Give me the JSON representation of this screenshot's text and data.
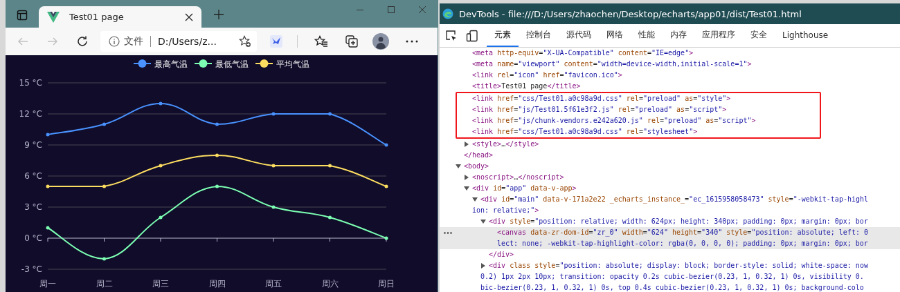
{
  "browser": {
    "tab": {
      "title": "Test01 page"
    },
    "nav_buttons": [
      {
        "kind": "back",
        "disabled": true
      },
      {
        "kind": "forward",
        "disabled": true
      },
      {
        "kind": "refresh",
        "disabled": false
      }
    ],
    "address": {
      "site_label": "文件",
      "url": "D:/Users/z..."
    },
    "chart": {
      "chart_data": {
        "type": "line",
        "grid": true,
        "legend": true,
        "categories": [
          "周一",
          "周二",
          "周三",
          "周四",
          "周五",
          "周六",
          "周日"
        ],
        "series": [
          {
            "name": "最高气温",
            "color": "#4992ff",
            "values": [
              10,
              11,
              13,
              11,
              12,
              12,
              9
            ]
          },
          {
            "name": "最低气温",
            "color": "#7cffb2",
            "values": [
              1,
              -2,
              2,
              5,
              3,
              2,
              0
            ]
          },
          {
            "name": "平均气温",
            "color": "#fddd60",
            "values": [
              5,
              5,
              7,
              8,
              7,
              7,
              5
            ]
          }
        ],
        "ylim": [
          -3,
          15
        ],
        "yticks": [
          {
            "value": -3,
            "label": "-3 °C"
          },
          {
            "value": 0,
            "label": "0 °C"
          },
          {
            "value": 3,
            "label": "3 °C"
          },
          {
            "value": 6,
            "label": "6 °C"
          },
          {
            "value": 9,
            "label": "9 °C"
          },
          {
            "value": 12,
            "label": "12 °C"
          },
          {
            "value": 15,
            "label": "15 °C"
          }
        ]
      }
    }
  },
  "devtools": {
    "title": "DevTools - file:///D:/Users/zhaochen/Desktop/echarts/app01/dist/Test01.html",
    "tabs": [
      {
        "label": "元素",
        "selected": true
      },
      {
        "label": "控制台",
        "selected": false
      },
      {
        "label": "源代码",
        "selected": false
      },
      {
        "label": "网络",
        "selected": false
      },
      {
        "label": "性能",
        "selected": false
      },
      {
        "label": "内存",
        "selected": false
      },
      {
        "label": "应用程序",
        "selected": false
      },
      {
        "label": "安全",
        "selected": false
      },
      {
        "label": "Lighthouse",
        "selected": false
      }
    ],
    "dom_tree": [
      {
        "children": [
          {
            "lines": [
              "<meta http-equiv=\"X-UA-Compatible\" content=\"IE=edge\">"
            ],
            "selected": false
          },
          {
            "lines": [
              "<meta name=\"viewport\" content=\"width=device-width,initial-scale=1\">"
            ],
            "selected": false
          },
          {
            "lines": [
              "<link rel=\"icon\" href=\"favicon.ico\">"
            ],
            "selected": false
          },
          {
            "lines": [
              "<title>Test01 page</title>"
            ],
            "selected": false
          },
          {
            "lines": [
              "<link href=\"css/Test01.a0c98a9d.css\" rel=\"preload\" as=\"style\">"
            ],
            "selected": false,
            "boxed": true
          },
          {
            "lines": [
              "<link href=\"js/Test01.5f61e3f2.js\" rel=\"preload\" as=\"script\">"
            ],
            "selected": false,
            "boxed": true
          },
          {
            "lines": [
              "<link href=\"js/chunk-vendors.e242a620.js\" rel=\"preload\" as=\"script\">"
            ],
            "selected": false,
            "boxed": true
          },
          {
            "lines": [
              "<link href=\"css/Test01.a0c98a9d.css\" rel=\"stylesheet\">"
            ],
            "selected": false,
            "boxed": true
          },
          {
            "lines": [
              "<style>…</style>"
            ],
            "expanded": false,
            "selected": false
          }
        ],
        "closing": "</head>"
      },
      {
        "lines": [
          "<body>"
        ],
        "expanded": true,
        "selected": false,
        "children": [
          {
            "lines": [
              "<noscript>…</noscript>"
            ],
            "expanded": false,
            "selected": false
          },
          {
            "lines": [
              "<div id=\"app\" data-v-app>"
            ],
            "expanded": true,
            "selected": false,
            "children": [
              {
                "lines": [
                  "<div id=\"main\" data-v-171a2e22 _echarts_instance_=\"ec_1615958058473\" style=\"-webkit-tap-highl",
                  "ion: relative;\">"
                ],
                "expanded": true,
                "selected": false,
                "children": [
                  {
                    "lines": [
                      "<div style=\"position: relative; width: 624px; height: 340px; padding: 0px; margin: 0px; bor"
                    ],
                    "expanded": true,
                    "selected": false,
                    "children": [
                      {
                        "lines": [
                          "<canvas data-zr-dom-id=\"zr_0\" width=\"624\" height=\"340\" style=\"position: absolute; left: 0",
                          "lect: none; -webkit-tap-highlight-color: rgba(0, 0, 0, 0); padding: 0px; margin: 0px; bor"
                        ],
                        "selected": true
                      }
                    ],
                    "closing": "</div>"
                  },
                  {
                    "lines": [
                      "<div class style=\"position: absolute; display: block; border-style: solid; white-space: now",
                      "0.2) 1px 2px 10px; transition: opacity 0.2s cubic-bezier(0.23, 1, 0.32, 1) 0s, visibility 0.",
                      "bic-bezier(0.23, 1, 0.32, 1) 0s, top 0.4s cubic-bezier(0.23, 1, 0.32, 1) 0s; background-colo"
                    ],
                    "expanded": false,
                    "selected": false
                  }
                ]
              }
            ]
          }
        ]
      }
    ]
  }
}
